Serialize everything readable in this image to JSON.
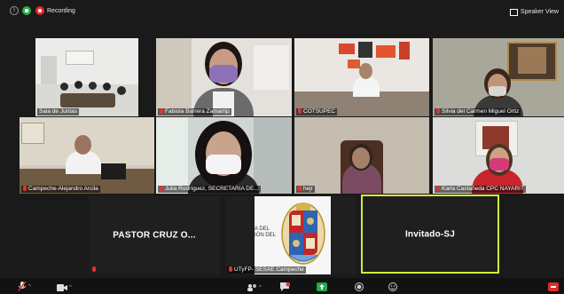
{
  "topbar": {
    "recording_label": "Recording",
    "view_label": "Speaker View"
  },
  "participants": [
    {
      "name": "Sala de Juntas"
    },
    {
      "name": "Fabiola Barrera Zamarrip"
    },
    {
      "name": "COTSUPEC"
    },
    {
      "name": "Silvia del Carmen Miguel Ortiz"
    },
    {
      "name": "Campeche-Alejandro Arcila"
    },
    {
      "name": "Julia Rodríguez, SECRETARIA DE..."
    },
    {
      "name": "hejr"
    },
    {
      "name": "Karla Castañeda CPC NAYARIT"
    },
    {
      "name": "PASTOR CRUZ O..."
    },
    {
      "name": "UTyFP- SESAE Campeche"
    },
    {
      "name": "Invitado-SJ"
    }
  ],
  "logo_text": [
    "A DEL",
    "IÓN DEL"
  ],
  "colors": {
    "background": "#1a1a1a",
    "recording_red": "#e02b2b",
    "security_green": "#23b148",
    "active_speaker_border": "#d8e93a",
    "chat_badge": "#e23a3a",
    "share_green": "#22a84a"
  }
}
